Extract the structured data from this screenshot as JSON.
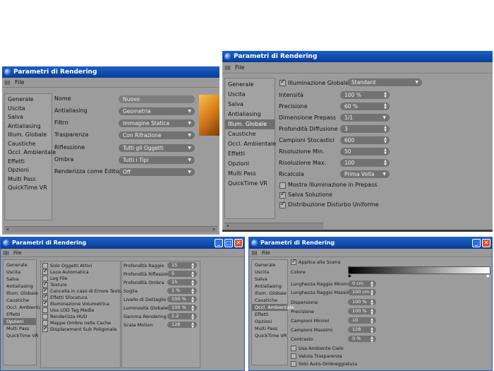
{
  "win1": {
    "title": "Parametri di Rendering",
    "menu": "File",
    "sidebar": [
      "Generale",
      "Uscita",
      "Salva",
      "Antialiasing",
      "Illum. Globale",
      "Caustiche",
      "Occl. Ambientale",
      "Effetti",
      "Opzioni",
      "Multi Pass",
      "QuickTime VR"
    ],
    "selected": "Generale",
    "fields": [
      {
        "label": "Nome",
        "value": "Nuovo"
      },
      {
        "label": "Antialiasing",
        "value": "Geometria"
      },
      {
        "label": "Filtro",
        "value": "Immagine Statica"
      },
      {
        "label": "Trasparenza",
        "value": "Con Rifrazione"
      },
      {
        "label": "Riflessione",
        "value": "Tutti gli Oggetti"
      },
      {
        "label": "Ombra",
        "value": "Tutti i Tipi"
      },
      {
        "label": "Renderizza come Editor",
        "value": "Off"
      }
    ]
  },
  "win2": {
    "title": "Parametri di Rendering",
    "menu": "File",
    "sidebar": [
      "Generale",
      "Uscita",
      "Salva",
      "Antialiasing",
      "Illum. Globale",
      "Caustiche",
      "Occl. Ambientale",
      "Effetti",
      "Opzioni",
      "Multi Pass",
      "QuickTime VR"
    ],
    "selected": "Illum. Globale",
    "gi_label": "Illuminazione Globale",
    "gi_mode": "Standard",
    "fields": [
      {
        "label": "Intensità",
        "value": "100 %"
      },
      {
        "label": "Precisione",
        "value": "60 %"
      },
      {
        "label": "Dimensione Prepass",
        "value": "1/1"
      },
      {
        "label": "Profondità Diffusione",
        "value": "3"
      },
      {
        "label": "Campioni Stocastici",
        "value": "600"
      },
      {
        "label": "Risoluzione Min.",
        "value": "50"
      },
      {
        "label": "Risoluzione Max.",
        "value": "100"
      },
      {
        "label": "Ricalcola",
        "value": "Prima Volta"
      }
    ],
    "checks": [
      {
        "label": "Mostra Illuminazione in Prepass",
        "on": false
      },
      {
        "label": "Salva Soluzione",
        "on": true
      },
      {
        "label": "Distribuzione Disturbo Uniforme",
        "on": true
      }
    ]
  },
  "win3": {
    "title": "Parametri di Rendering",
    "menu": "File",
    "sidebar": [
      "Generale",
      "Uscita",
      "Salva",
      "Antialiasing",
      "Illum. Globale",
      "Caustiche",
      "Occl. Ambientale",
      "Effetti",
      "Opzioni",
      "Multi Pass",
      "QuickTime VR"
    ],
    "selected": "Opzioni",
    "checks": [
      {
        "label": "Solo Oggetti Attivi",
        "on": false
      },
      {
        "label": "Luce Automatica",
        "on": true
      },
      {
        "label": "Log File",
        "on": false
      },
      {
        "label": "Texture",
        "on": true
      },
      {
        "label": "Cancella in caso di Errore Texture",
        "on": true
      },
      {
        "label": "Effetti Sfocatura",
        "on": true
      },
      {
        "label": "Illuminazione Volumetrica",
        "on": true
      },
      {
        "label": "Usa LOD Tag Media",
        "on": false
      },
      {
        "label": "Renderizza HUD",
        "on": false
      },
      {
        "label": "Mappe Ombre nella Cache",
        "on": false
      },
      {
        "label": "Displacement Sub Poligonale",
        "on": true
      }
    ],
    "fields": [
      {
        "label": "Profondità Raggio",
        "value": "15"
      },
      {
        "label": "Profondità Riflessione",
        "value": "5"
      },
      {
        "label": "Profondità Ombra",
        "value": "15"
      },
      {
        "label": "Soglia",
        "value": "1 %"
      },
      {
        "label": "Livello di Dettaglio",
        "value": "100 %"
      },
      {
        "label": "Luminosità Globale",
        "value": "100 %"
      },
      {
        "label": "Gamma Rendering",
        "value": "2.2"
      },
      {
        "label": "Scala Motion",
        "value": "128"
      }
    ]
  },
  "win4": {
    "title": "Parametri di Rendering",
    "menu": "File",
    "sidebar": [
      "Generale",
      "Uscita",
      "Salva",
      "Antialiasing",
      "Illum. Globale",
      "Caustiche",
      "Occl. Ambientale",
      "Effetti",
      "Opzioni",
      "Multi Pass",
      "QuickTime VR"
    ],
    "selected": "Occl. Ambientale",
    "apply_label": "Applica alla Scena",
    "color_label": "Colore",
    "fields": [
      {
        "label": "Lunghezza Raggio Minima",
        "value": "0 cm"
      },
      {
        "label": "Lunghezza Raggio Massima",
        "value": "100 cm"
      },
      {
        "label": "Dispersione",
        "value": "100 %"
      },
      {
        "label": "Precisione",
        "value": "100 %"
      },
      {
        "label": "Campioni Minimi",
        "value": "10"
      },
      {
        "label": "Campioni Massimi",
        "value": "128"
      },
      {
        "label": "Contrasto",
        "value": "0 %"
      }
    ],
    "checks": [
      {
        "label": "Usa Ambiente Cielo",
        "on": false
      },
      {
        "label": "Valuta Trasparenza",
        "on": false
      },
      {
        "label": "Solo Auto-Ombreggiatura",
        "on": false
      }
    ]
  }
}
